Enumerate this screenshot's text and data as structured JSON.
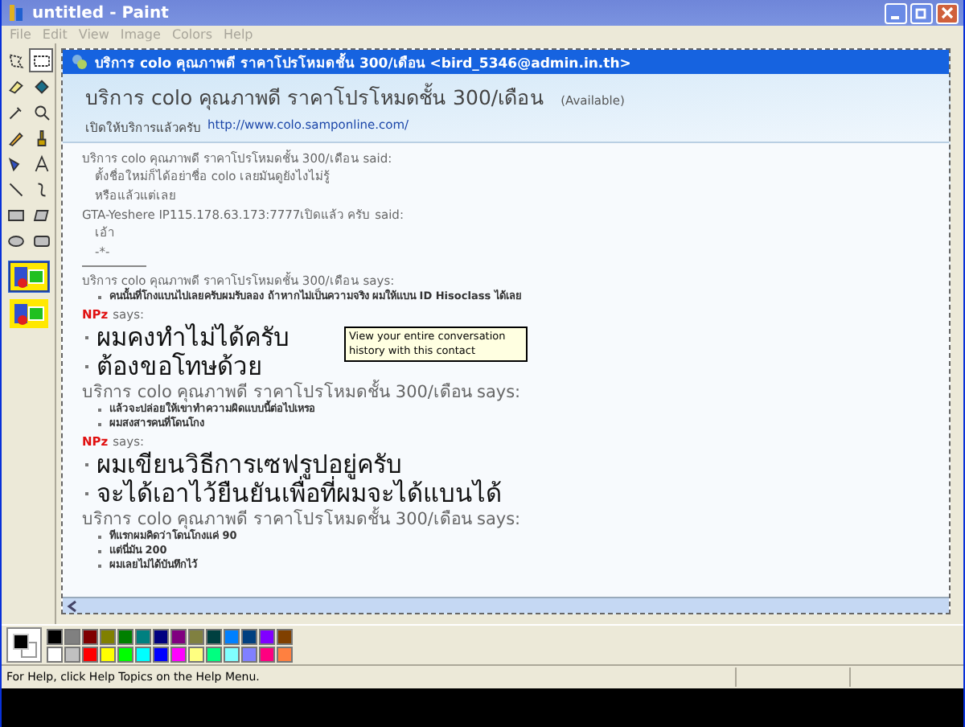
{
  "window": {
    "title": "untitled - Paint"
  },
  "menu": [
    "File",
    "Edit",
    "View",
    "Image",
    "Colors",
    "Help"
  ],
  "tools": [
    {
      "selected": false
    },
    {
      "selected": true
    },
    {
      "selected": false
    },
    {
      "selected": false
    },
    {
      "selected": false
    },
    {
      "selected": false
    },
    {
      "selected": false
    },
    {
      "selected": false
    },
    {
      "selected": false
    },
    {
      "selected": false
    },
    {
      "selected": false
    },
    {
      "selected": false
    },
    {
      "selected": false
    },
    {
      "selected": false
    },
    {
      "selected": false
    },
    {
      "selected": false
    }
  ],
  "chat": {
    "title": "บริการ colo คุณภาพดี ราคาโปรโหมดชั้น 300/เดือน <bird_5346@admin.in.th>",
    "contact_name": "บริการ colo คุณภาพดี ราคาโปรโหมดชั้น 300/เดือน",
    "status": "(Available)",
    "personal_message": "เปิดให้บริการแล้วครับ",
    "link": "http://www.colo.samponline.com/",
    "messages": [
      {
        "sender": "บริการ colo คุณภาพดี ราคาโปรโหมดชั้น 300/เดือน",
        "verb": "said:",
        "kind": "plain",
        "sender_highlight": false,
        "large_header": false,
        "lines": [
          "ตั้งชื่อใหม่ก็ได้อย่าชื่อ colo เลยมันดูยังไงไม่รู้",
          "หรือแล้วแต่เลย"
        ]
      },
      {
        "sender": "GTA-Yeshere IP115.178.63.173:7777เปิดแล้ว ครับ",
        "verb": "said:",
        "kind": "plain",
        "sender_highlight": false,
        "large_header": false,
        "lines": [
          "เอ้า",
          "-*-"
        ]
      },
      {
        "sender": "บริการ colo คุณภาพดี ราคาโปรโหมดชั้น 300/เดือน",
        "verb": "says:",
        "kind": "bold",
        "sender_highlight": false,
        "large_header": false,
        "separator_before": true,
        "lines": [
          "คนนั้นที่โกงแบนไปเลยครับผมรับลอง ถ้าหากไม่เป็นความจริง ผมให้แบน ID Hisoclass ได้เลย"
        ]
      },
      {
        "sender": "NPz",
        "verb": "says:",
        "kind": "big",
        "sender_highlight": true,
        "large_header": false,
        "lines": [
          "ผมคงทำไม่ได้ครับ",
          "ต้องขอโทษด้วย"
        ]
      },
      {
        "sender": "บริการ colo คุณภาพดี ราคาโปรโหมดชั้น 300/เดือน",
        "verb": "says:",
        "kind": "bold",
        "sender_highlight": false,
        "large_header": true,
        "lines": [
          "แล้วจะปล่อยให้เขาทำความผิดแบบนี้ต่อไปเหรอ",
          "ผมสงสารคนที่โดนโกง"
        ]
      },
      {
        "sender": "NPz",
        "verb": "says:",
        "kind": "big",
        "sender_highlight": true,
        "large_header": false,
        "lines": [
          "ผมเขียนวิธีการเซฟรูปอยู่ครับ",
          "จะได้เอาไว้ยืนยันเพื่อที่ผมจะได้แบนได้"
        ]
      },
      {
        "sender": "บริการ colo คุณภาพดี ราคาโปรโหมดชั้น 300/เดือน",
        "verb": "says:",
        "kind": "bold",
        "sender_highlight": false,
        "large_header": true,
        "lines": [
          "ทีแรกผมคิดว่าโดนโกงแค่ 90",
          "แต่นี่มัน 200",
          "ผมเลยไม่ได้บันทึกไว้"
        ]
      }
    ],
    "tooltip": "View your entire conversation history with this contact"
  },
  "palette": [
    {
      "color": "#000000"
    },
    {
      "color": "#808080"
    },
    {
      "color": "#800000"
    },
    {
      "color": "#808000"
    },
    {
      "color": "#008000"
    },
    {
      "color": "#008080"
    },
    {
      "color": "#000080"
    },
    {
      "color": "#800080"
    },
    {
      "color": "#808040"
    },
    {
      "color": "#004040"
    },
    {
      "color": "#0080ff"
    },
    {
      "color": "#004080"
    },
    {
      "color": "#8000ff"
    },
    {
      "color": "#804000"
    },
    {
      "color": "#ffffff"
    },
    {
      "color": "#c0c0c0"
    },
    {
      "color": "#ff0000"
    },
    {
      "color": "#ffff00"
    },
    {
      "color": "#00ff00"
    },
    {
      "color": "#00ffff"
    },
    {
      "color": "#0000ff"
    },
    {
      "color": "#ff00ff"
    },
    {
      "color": "#ffff80"
    },
    {
      "color": "#00ff80"
    },
    {
      "color": "#80ffff"
    },
    {
      "color": "#8080ff"
    },
    {
      "color": "#ff0080"
    },
    {
      "color": "#ff8040"
    }
  ],
  "status_bar": "For Help, click Help Topics on the Help Menu."
}
